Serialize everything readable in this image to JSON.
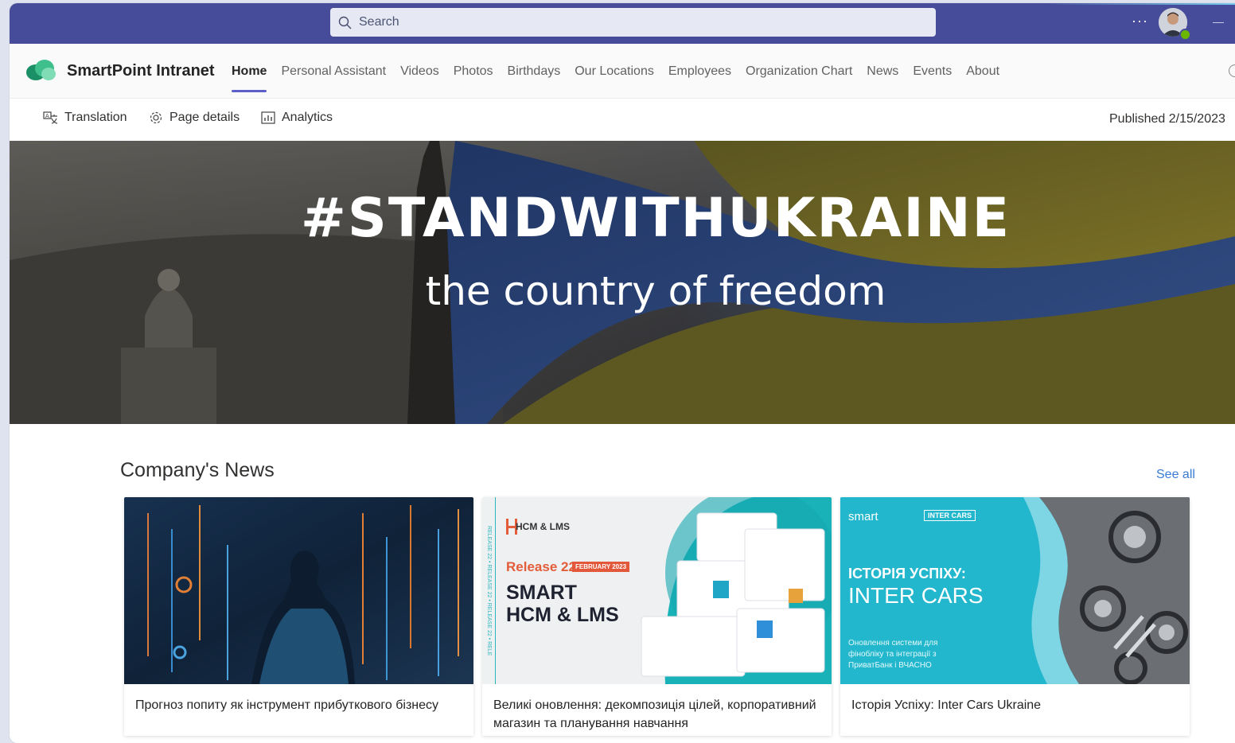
{
  "topbar": {
    "search_placeholder": "Search",
    "more_label": "···"
  },
  "site": {
    "title": "SmartPoint Intranet"
  },
  "nav": {
    "items": [
      {
        "label": "Home",
        "active": true
      },
      {
        "label": "Personal Assistant"
      },
      {
        "label": "Videos"
      },
      {
        "label": "Photos"
      },
      {
        "label": "Birthdays"
      },
      {
        "label": "Our Locations"
      },
      {
        "label": "Employees"
      },
      {
        "label": "Organization Chart"
      },
      {
        "label": "News"
      },
      {
        "label": "Events"
      },
      {
        "label": "About"
      }
    ]
  },
  "commands": {
    "translation": "Translation",
    "page_details": "Page details",
    "analytics": "Analytics",
    "published": "Published 2/15/2023"
  },
  "hero": {
    "title": "#STANDWITHUKRAINE",
    "subtitle": "the country of freedom",
    "colors": {
      "flag_blue": "#2b4a85",
      "flag_yellow": "#6b6422"
    }
  },
  "news": {
    "section_title": "Company's News",
    "see_all": "See all",
    "cards": [
      {
        "caption": "Прогноз попиту як інструмент прибуткового бізнесу"
      },
      {
        "caption": "Великі оновлення: декомпозиція цілей, корпоративний магазин та планування навчання",
        "image": {
          "brand": "HCM & LMS",
          "release": "Release 22",
          "badge": "FEBRUARY 2023",
          "title_line1": "SMART",
          "title_line2": "HCM & LMS",
          "strip": "RELEASE 22 • RELEASE 22 • RELEASE 22 • RELE"
        }
      },
      {
        "caption": "Історія Успіху: Inter Cars Ukraine",
        "image": {
          "brand": "smart",
          "partner": "INTER CARS",
          "heading": "ІСТОРІЯ УСПІХУ:",
          "subheading": "INTER CARS",
          "note": "Оновлення системи для фінобліку та інтеграції з ПриватБанк і ВЧАСНО"
        }
      }
    ]
  },
  "theme": {
    "topbar_bg": "#464c9a",
    "accent": "#5b5fc7",
    "link": "#3a7bd5"
  }
}
